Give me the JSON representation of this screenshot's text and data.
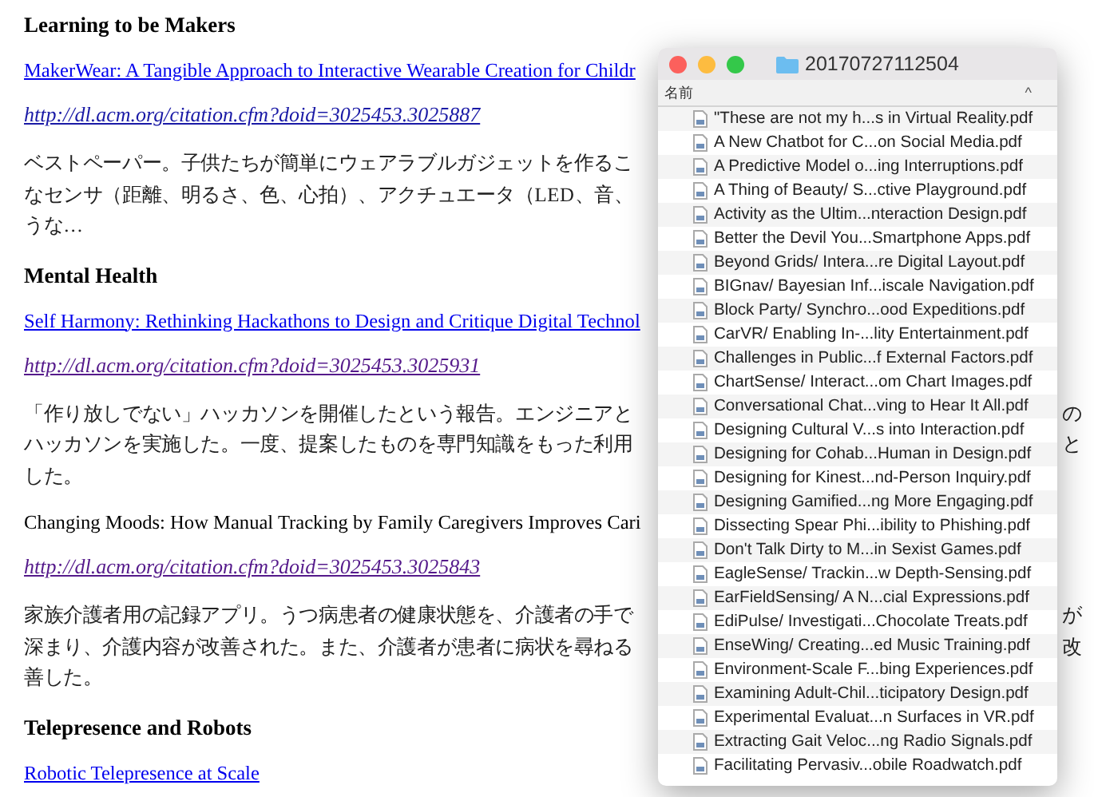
{
  "article": [
    {
      "kind": "heading",
      "text": "Learning to be Makers"
    },
    {
      "kind": "link",
      "text": "MakerWear: A Tangible Approach to Interactive Wearable Creation for Childr"
    },
    {
      "kind": "url",
      "text": "http://dl.acm.org/citation.cfm?doid=3025453.3025887",
      "visited": false
    },
    {
      "kind": "paragraph",
      "lines": [
        {
          "text": "ベストペーパー。子供たちが簡単にウェアラブルガジェットを作るこ"
        },
        {
          "text": "なセンサ（距離、明るさ、色、心拍）、アクチュエータ（LED、音、"
        },
        {
          "text": "うな…"
        }
      ]
    },
    {
      "kind": "heading",
      "text": "Mental Health"
    },
    {
      "kind": "link",
      "text": "Self Harmony: Rethinking Hackathons to Design and Critique Digital Technol"
    },
    {
      "kind": "url",
      "text": "http://dl.acm.org/citation.cfm?doid=3025453.3025931",
      "visited": true
    },
    {
      "kind": "paragraph",
      "lines": [
        {
          "text": "「作り放しでない」ハッカソンを開催したという報告。エンジニアと",
          "right": "の"
        },
        {
          "text": "ハッカソンを実施した。一度、提案したものを専門知識をもった利用",
          "right": "と"
        },
        {
          "text": "した。"
        }
      ]
    },
    {
      "kind": "plain",
      "text": "Changing Moods: How Manual Tracking by Family Caregivers Improves Cari"
    },
    {
      "kind": "url",
      "text": "http://dl.acm.org/citation.cfm?doid=3025453.3025843",
      "visited": true
    },
    {
      "kind": "paragraph",
      "lines": [
        {
          "text": "家族介護者用の記録アプリ。うつ病患者の健康状態を、介護者の手で",
          "right": "が"
        },
        {
          "text": "深まり、介護内容が改善された。また、介護者が患者に病状を尋ねる",
          "right": "改"
        },
        {
          "text": "善した。"
        }
      ]
    },
    {
      "kind": "heading",
      "text": "Telepresence and Robots"
    },
    {
      "kind": "link",
      "text": "Robotic Telepresence at Scale"
    }
  ],
  "finder": {
    "title": "20170727112504",
    "column": "名前",
    "sort": "^",
    "files": [
      "\"These are not my h...s in Virtual Reality.pdf",
      "A New Chatbot for C...on Social Media.pdf",
      "A Predictive Model o...ing Interruptions.pdf",
      "A Thing of Beauty/ S...ctive Playground.pdf",
      "Activity as the Ultim...nteraction Design.pdf",
      "Better the Devil You...Smartphone Apps.pdf",
      "Beyond Grids/ Intera...re Digital Layout.pdf",
      "BIGnav/ Bayesian Inf...iscale Navigation.pdf",
      "Block Party/ Synchro...ood Expeditions.pdf",
      "CarVR/ Enabling In-...lity Entertainment.pdf",
      "Challenges in Public...f External Factors.pdf",
      "ChartSense/ Interact...om Chart Images.pdf",
      "Conversational Chat...ving to Hear It All.pdf",
      "Designing Cultural V...s into Interaction.pdf",
      "Designing for Cohab...Human in Design.pdf",
      "Designing for Kinest...nd-Person Inquiry.pdf",
      "Designing Gamified...ng More Engaging.pdf",
      "Dissecting Spear Phi...ibility to Phishing.pdf",
      "Don't Talk Dirty to M...in Sexist Games.pdf",
      "EagleSense/ Trackin...w Depth-Sensing.pdf",
      "EarFieldSensing/ A N...cial Expressions.pdf",
      "EdiPulse/ Investigati...Chocolate Treats.pdf",
      "EnseWing/ Creating...ed Music Training.pdf",
      "Environment-Scale F...bing Experiences.pdf",
      "Examining Adult-Chil...ticipatory Design.pdf",
      "Experimental Evaluat...n Surfaces in VR.pdf",
      "Extracting Gait Veloc...ng Radio Signals.pdf",
      "Facilitating Pervasiv...obile Roadwatch.pdf"
    ]
  }
}
